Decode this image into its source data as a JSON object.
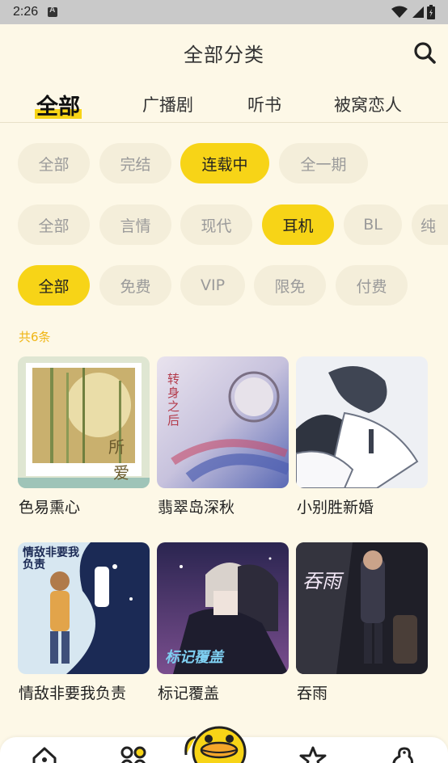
{
  "status": {
    "time": "2:26"
  },
  "header": {
    "title": "全部分类"
  },
  "tabs": [
    {
      "label": "全部",
      "active": true
    },
    {
      "label": "广播剧",
      "active": false
    },
    {
      "label": "听书",
      "active": false
    },
    {
      "label": "被窝恋人",
      "active": false
    }
  ],
  "filters": {
    "status": [
      "全部",
      "完结",
      "连载中",
      "全一期"
    ],
    "status_selected": "连载中",
    "genre": [
      "全部",
      "言情",
      "现代",
      "耳机",
      "BL",
      "纯"
    ],
    "genre_selected": "耳机",
    "price": [
      "全部",
      "免费",
      "VIP",
      "限免",
      "付费"
    ],
    "price_selected": "全部"
  },
  "result_count": "共6条",
  "items": [
    {
      "title": "色易熏心",
      "cover_text": [
        "所",
        "爱"
      ]
    },
    {
      "title": "翡翠岛深秋",
      "cover_text": [
        "转身之后"
      ]
    },
    {
      "title": "小别胜新婚",
      "cover_text": []
    },
    {
      "title": "情敌非要我负责",
      "cover_text": [
        "情敌非要我负责"
      ]
    },
    {
      "title": "标记覆盖",
      "cover_text": [
        "标记覆盖"
      ]
    },
    {
      "title": "吞雨",
      "cover_text": [
        "吞雨"
      ]
    }
  ],
  "colors": {
    "accent": "#f7d417",
    "background": "#fdf8e7",
    "chip": "#f4eeda",
    "count": "#f0b514"
  }
}
